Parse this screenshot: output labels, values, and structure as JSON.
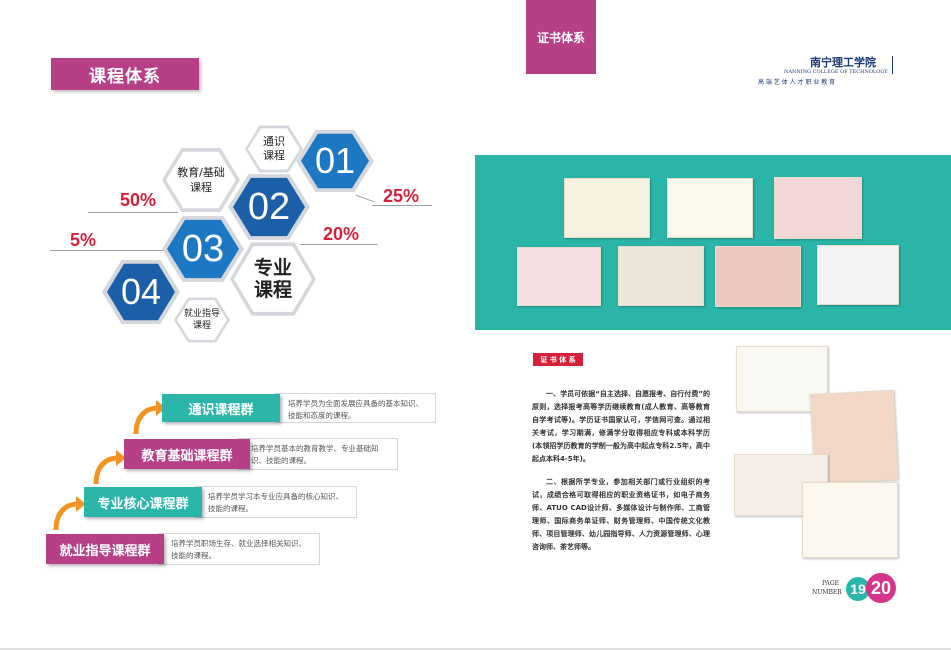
{
  "left": {
    "title": "课程体系",
    "hexes": [
      {
        "label": "通识\n课程"
      },
      {
        "label": "01"
      },
      {
        "label": "教育/基础\n课程"
      },
      {
        "label": "02"
      },
      {
        "label": "03"
      },
      {
        "label": "专业\n课程"
      },
      {
        "label": "04"
      },
      {
        "label": "就业指导\n课程"
      }
    ],
    "percents": {
      "p25": "25%",
      "p50": "50%",
      "p20": "20%",
      "p5": "5%"
    },
    "groups": [
      {
        "name": "通识课程群",
        "desc": "培养学员为全面发展应具备的基本知识、技能和态度的课程。"
      },
      {
        "name": "教育基础课程群",
        "desc": "培养学员基本的教育教学、专业基础知识、技能的课程。"
      },
      {
        "name": "专业核心课程群",
        "desc": "培养学员学习本专业应具备的核心知识、技能的课程。"
      },
      {
        "name": "就业指导课程群",
        "desc": "培养学员职场生存、就业选择相关知识、技能的课程。"
      }
    ]
  },
  "right": {
    "tag": "证书体系",
    "school_cn": "南宁理工学院",
    "school_en": "NANNING COLLEGE OF TECHNOLOGY",
    "slogan": "高 端 艺 体 人 才 职 业 教 育",
    "section_label": "证 书 体 系",
    "para1": "一、学员可依据“自主选择、自愿报考、自行付费”的原则，选择报考高等学历继续教育(成人教育、高等教育自学考试等)。学历证书国家认可，学信网可查。通过相关考试，学习期满，修满学分取得相应专科或本科学历(本领招学历教育的学制一般为高中起点专科2.5年，高中起点本科4-5年)。",
    "para2": "二、根据所学专业，参加相关部门或行业组织的考试，成绩合格可取得相应的职业资格证书，如电子商务师、ATUO CAD设计师、多媒体设计与制作师、工商管理师、国际商务单证师、财务管理师、中国传统文化教师、项目管理师、幼儿园指导师、人力资源管理师、心理咨询师、茶艺师等。",
    "page_label_1": "PAGE",
    "page_label_2": "NUMBER",
    "page_left": "19",
    "page_right": "20"
  },
  "colors": {
    "magenta": "#b63f86",
    "blue": "#1a5fa8",
    "teal": "#2bb5a9",
    "red": "#d6213a",
    "orange": "#f39321",
    "green": "#77b947"
  }
}
